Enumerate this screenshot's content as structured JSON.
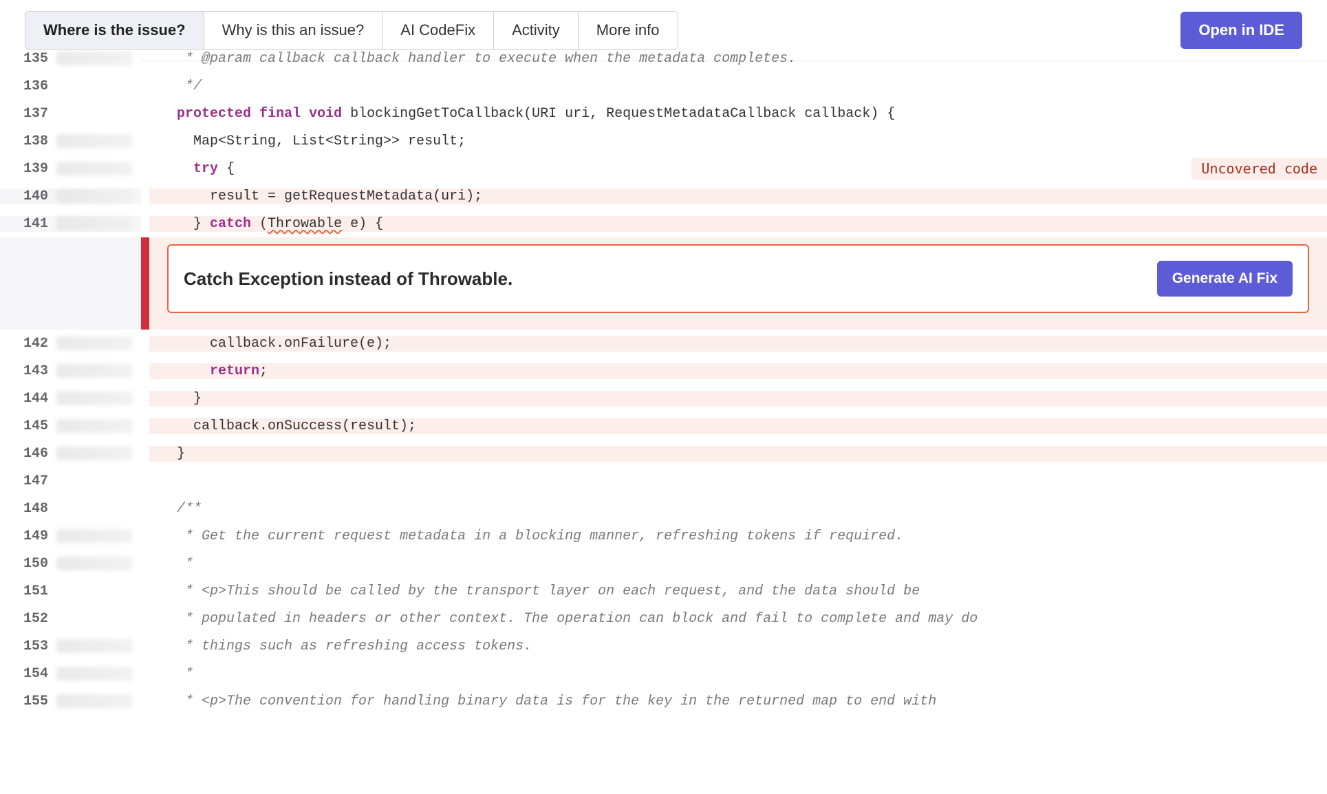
{
  "header": {
    "tabs": [
      {
        "label": "Where is the issue?",
        "active": true
      },
      {
        "label": "Why is this an issue?",
        "active": false
      },
      {
        "label": "AI CodeFix",
        "active": false
      },
      {
        "label": "Activity",
        "active": false
      },
      {
        "label": "More info",
        "active": false
      }
    ],
    "open_ide_label": "Open in IDE"
  },
  "issue": {
    "message": "Catch Exception instead of Throwable.",
    "fix_button_label": "Generate AI Fix"
  },
  "badges": {
    "uncovered": "Uncovered code"
  },
  "code": {
    "lines": [
      {
        "n": 135,
        "blame": true,
        "hl": false,
        "tokens": [
          [
            "   ",
            ""
          ],
          [
            "* @param callback callback handler to execute when the metadata completes.",
            "cmt"
          ]
        ]
      },
      {
        "n": 136,
        "blame": false,
        "hl": false,
        "tokens": [
          [
            "   ",
            ""
          ],
          [
            "*/",
            "cmt"
          ]
        ]
      },
      {
        "n": 137,
        "blame": false,
        "hl": false,
        "tokens": [
          [
            "  ",
            ""
          ],
          [
            "protected",
            "kw"
          ],
          [
            " ",
            ""
          ],
          [
            "final",
            "kw"
          ],
          [
            " ",
            ""
          ],
          [
            "void",
            "kw"
          ],
          [
            " blockingGetToCallback(URI uri, RequestMetadataCallback callback) {",
            ""
          ]
        ]
      },
      {
        "n": 138,
        "blame": true,
        "hl": false,
        "tokens": [
          [
            "    Map<String, List<String>> result;",
            ""
          ]
        ]
      },
      {
        "n": 139,
        "blame": true,
        "hl": false,
        "tokens": [
          [
            "    ",
            ""
          ],
          [
            "try",
            "kw"
          ],
          [
            " {",
            ""
          ]
        ]
      },
      {
        "n": 140,
        "blame": true,
        "hl": "red",
        "tokens": [
          [
            "      result = getRequestMetadata(uri);",
            ""
          ]
        ]
      },
      {
        "n": 141,
        "blame": true,
        "hl": "red",
        "tokens": [
          [
            "    } ",
            ""
          ],
          [
            "catch",
            "kw"
          ],
          [
            " (",
            ""
          ],
          [
            "Throwable",
            "squiggle"
          ],
          [
            " e) {",
            ""
          ]
        ]
      },
      {
        "n": 142,
        "blame": true,
        "hl": "redr",
        "tokens": [
          [
            "      callback.onFailure(e);",
            ""
          ]
        ]
      },
      {
        "n": 143,
        "blame": true,
        "hl": "redr",
        "tokens": [
          [
            "      ",
            ""
          ],
          [
            "return",
            "kw"
          ],
          [
            ";",
            ""
          ]
        ]
      },
      {
        "n": 144,
        "blame": true,
        "hl": "redr",
        "tokens": [
          [
            "    }",
            ""
          ]
        ]
      },
      {
        "n": 145,
        "blame": true,
        "hl": "redr",
        "tokens": [
          [
            "    callback.onSuccess(result);",
            ""
          ]
        ]
      },
      {
        "n": 146,
        "blame": true,
        "hl": "redr",
        "tokens": [
          [
            "  }",
            ""
          ]
        ]
      },
      {
        "n": 147,
        "blame": false,
        "hl": false,
        "tokens": [
          [
            "",
            ""
          ]
        ]
      },
      {
        "n": 148,
        "blame": false,
        "hl": false,
        "tokens": [
          [
            "  ",
            ""
          ],
          [
            "/**",
            "cmt"
          ]
        ]
      },
      {
        "n": 149,
        "blame": true,
        "hl": false,
        "tokens": [
          [
            "   ",
            ""
          ],
          [
            "* Get the current request metadata in a blocking manner, refreshing tokens if required.",
            "cmt"
          ]
        ]
      },
      {
        "n": 150,
        "blame": true,
        "hl": false,
        "tokens": [
          [
            "   ",
            ""
          ],
          [
            "*",
            "cmt"
          ]
        ]
      },
      {
        "n": 151,
        "blame": false,
        "hl": false,
        "tokens": [
          [
            "   ",
            ""
          ],
          [
            "* <p>This should be called by the transport layer on each request, and the data should be",
            "cmt"
          ]
        ]
      },
      {
        "n": 152,
        "blame": false,
        "hl": false,
        "tokens": [
          [
            "   ",
            ""
          ],
          [
            "* populated in headers or other context. The operation can block and fail to complete and may do",
            "cmt"
          ]
        ]
      },
      {
        "n": 153,
        "blame": true,
        "hl": false,
        "tokens": [
          [
            "   ",
            ""
          ],
          [
            "* things such as refreshing access tokens.",
            "cmt"
          ]
        ]
      },
      {
        "n": 154,
        "blame": true,
        "hl": false,
        "tokens": [
          [
            "   ",
            ""
          ],
          [
            "*",
            "cmt"
          ]
        ]
      },
      {
        "n": 155,
        "blame": true,
        "hl": false,
        "tokens": [
          [
            "   ",
            ""
          ],
          [
            "* <p>The convention for handling binary data is for the key in the returned map to end with",
            "cmt"
          ]
        ]
      }
    ],
    "issue_after_line": 141
  }
}
